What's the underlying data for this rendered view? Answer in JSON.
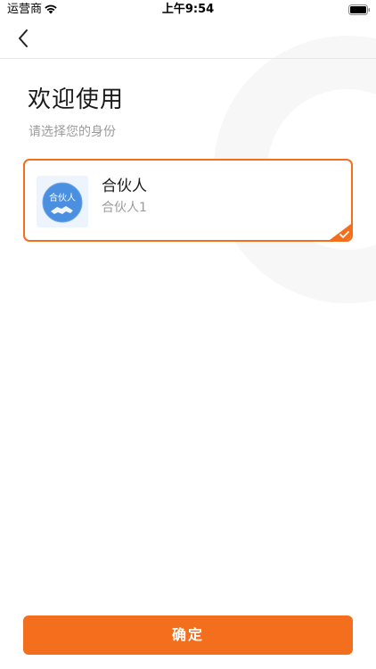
{
  "status_bar": {
    "carrier": "运营商",
    "time": "上午9:54",
    "wifi_icon": "wifi-icon",
    "battery_icon": "battery-icon"
  },
  "nav": {
    "back_icon": "chevron-left-icon"
  },
  "header": {
    "title": "欢迎使用",
    "subtitle": "请选择您的身份"
  },
  "roles": [
    {
      "icon_label": "合伙人",
      "name": "合伙人",
      "description": "合伙人1",
      "selected": true
    }
  ],
  "footer": {
    "confirm_label": "确定"
  },
  "colors": {
    "accent": "#f36f1e",
    "avatar_bg": "#edf4fd",
    "avatar_circle": "#4a8fe0",
    "muted_text": "#9b9b9b"
  }
}
